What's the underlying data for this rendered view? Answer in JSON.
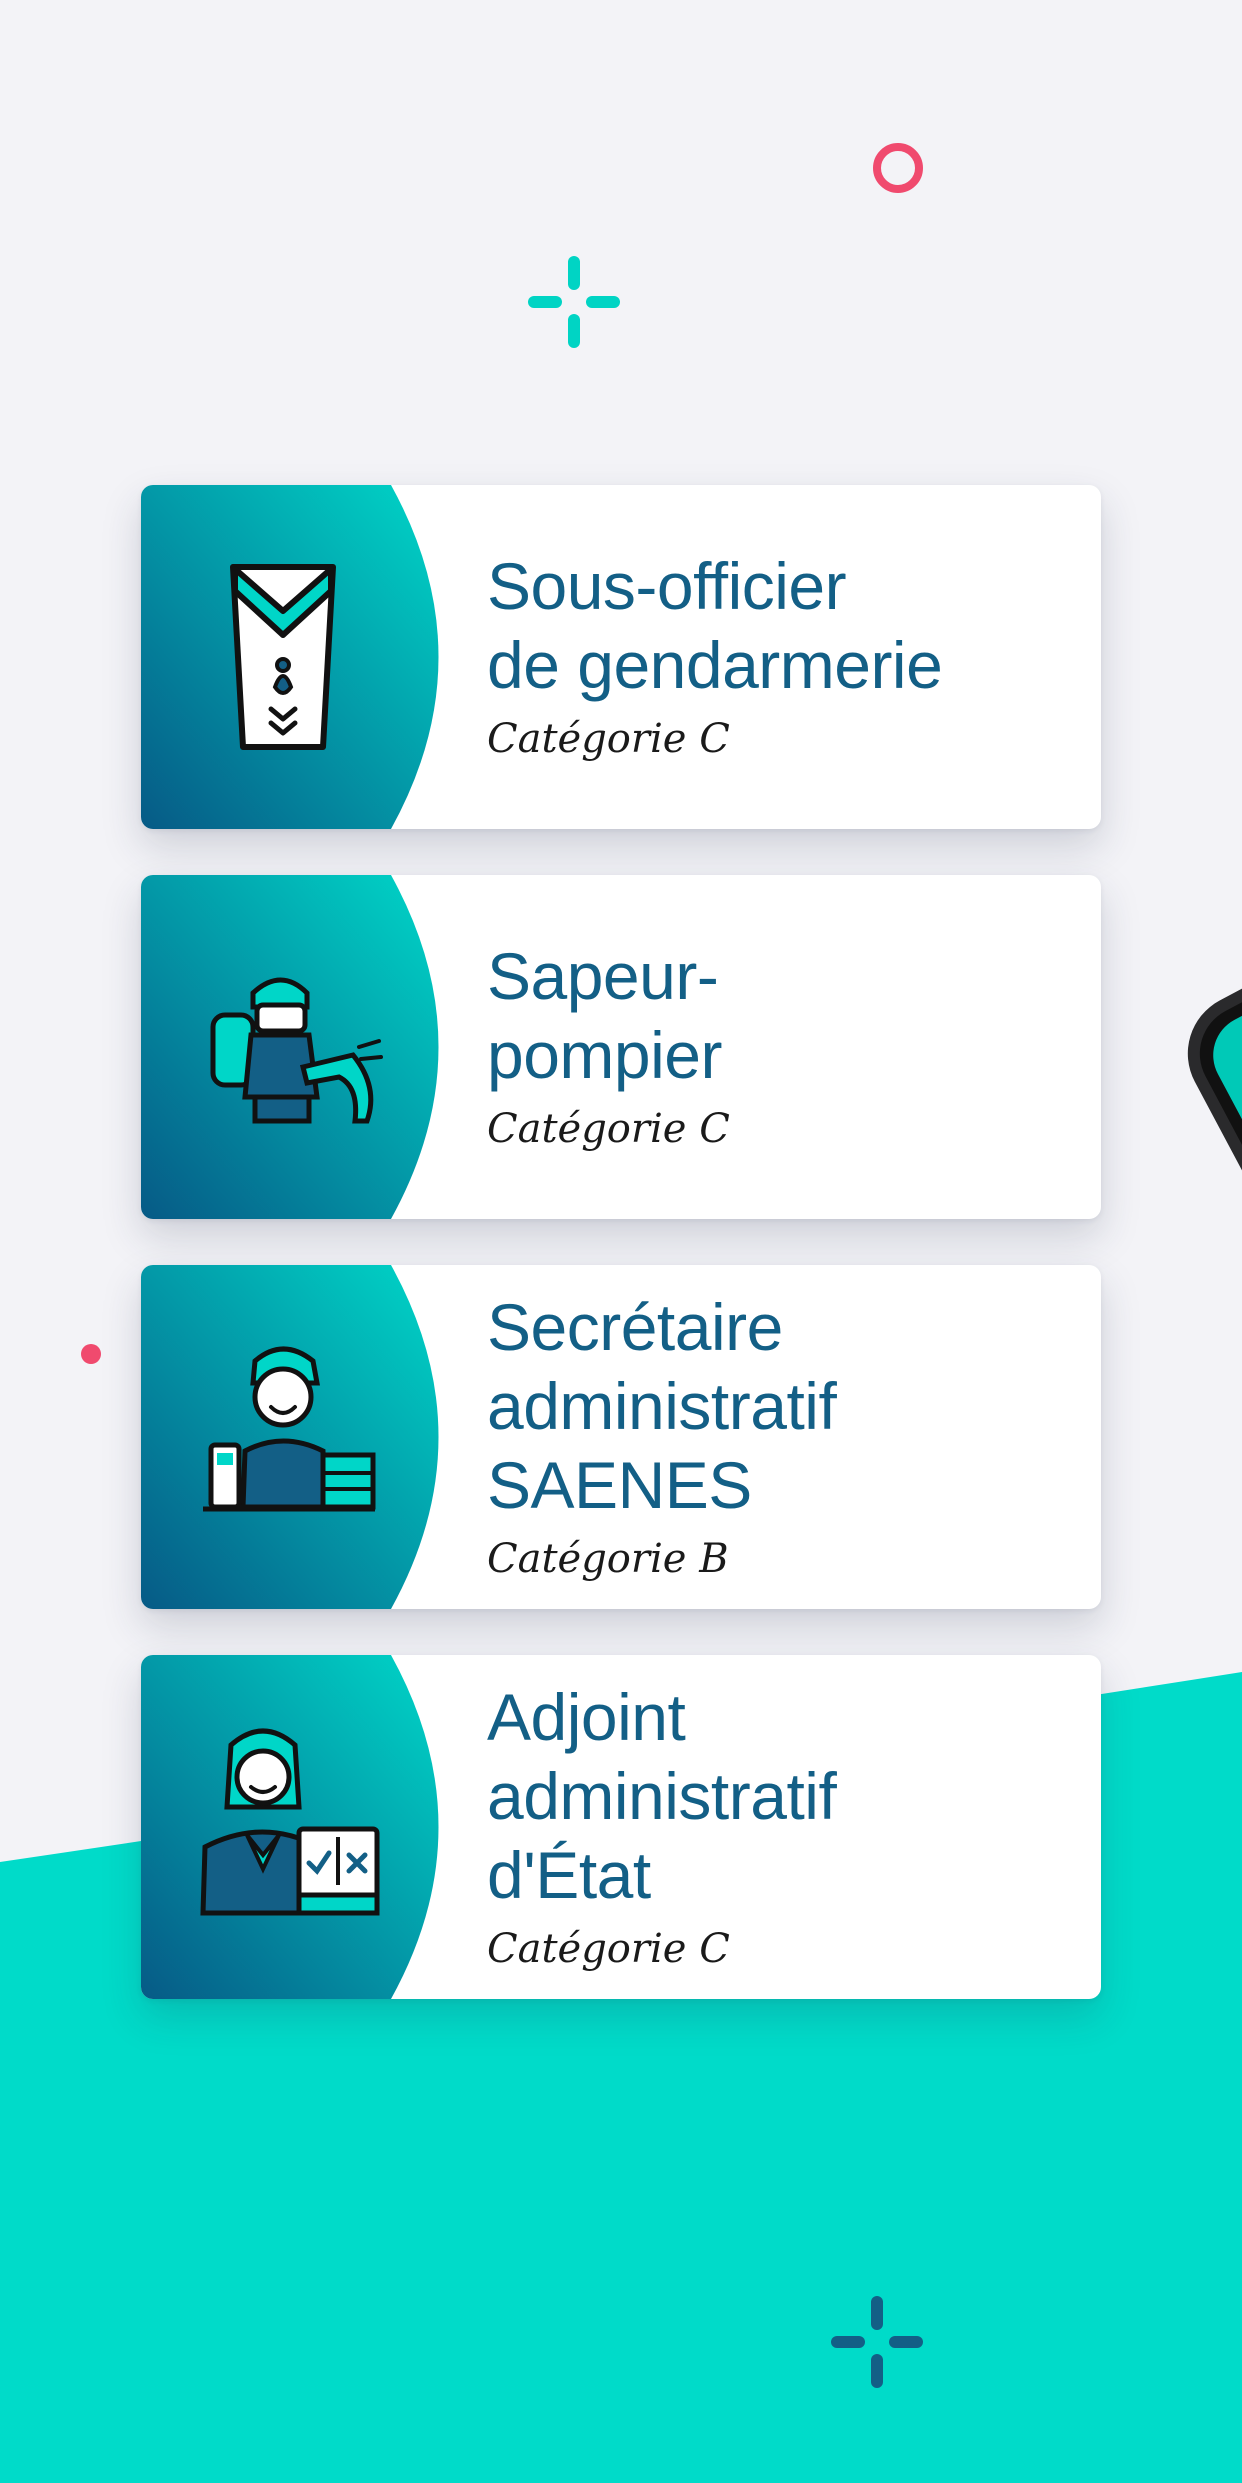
{
  "theme": {
    "background": "#f3f3f7",
    "teal": "#00dbc9",
    "navy": "#135f86",
    "pink": "#f04a6e"
  },
  "cards": [
    {
      "title": "Sous-officier\nde gendarmerie",
      "category": "Catégorie C",
      "icon": "gendarmerie-insignia-icon"
    },
    {
      "title": "Sapeur-\npompier",
      "category": "Catégorie C",
      "icon": "firefighter-icon"
    },
    {
      "title": "Secrétaire\nadministratif\nSAENES",
      "category": "Catégorie B",
      "icon": "secretary-icon"
    },
    {
      "title": "Adjoint\nadministratif\nd'État",
      "category": "Catégorie C",
      "icon": "administrative-assistant-icon"
    }
  ]
}
